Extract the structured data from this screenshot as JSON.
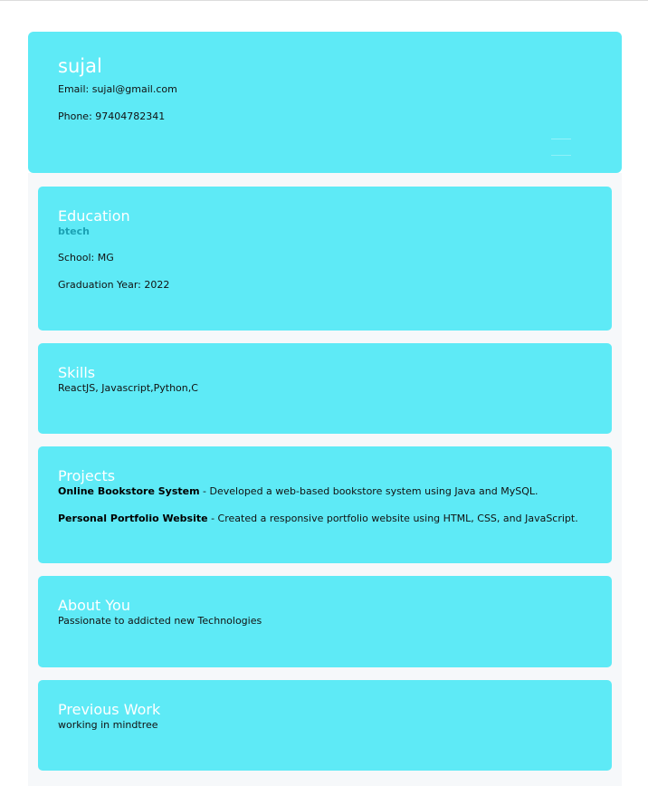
{
  "profile": {
    "name": "sujal",
    "email_label": "Email: sujal@gmail.com",
    "phone_label": "Phone: 97404782341"
  },
  "education": {
    "title": "Education",
    "degree": "btech",
    "school": "School: MG",
    "graduation": "Graduation Year: 2022"
  },
  "skills": {
    "title": "Skills",
    "text": "ReactJS, Javascript,Python,C"
  },
  "projects": {
    "title": "Projects",
    "items": [
      {
        "name": "Online Bookstore System",
        "desc": " - Developed a web-based bookstore system using Java and MySQL."
      },
      {
        "name": "Personal Portfolio Website",
        "desc": " - Created a responsive portfolio website using HTML, CSS, and JavaScript."
      }
    ]
  },
  "about": {
    "title": "About You",
    "text": "Passionate to addicted new Technologies"
  },
  "previous_work": {
    "title": "Previous Work",
    "text": "working in mindtree"
  },
  "colors": {
    "card": "#5eeaf6",
    "degree_text": "#1ba1b3",
    "page_bg": "#f6f8fa"
  }
}
